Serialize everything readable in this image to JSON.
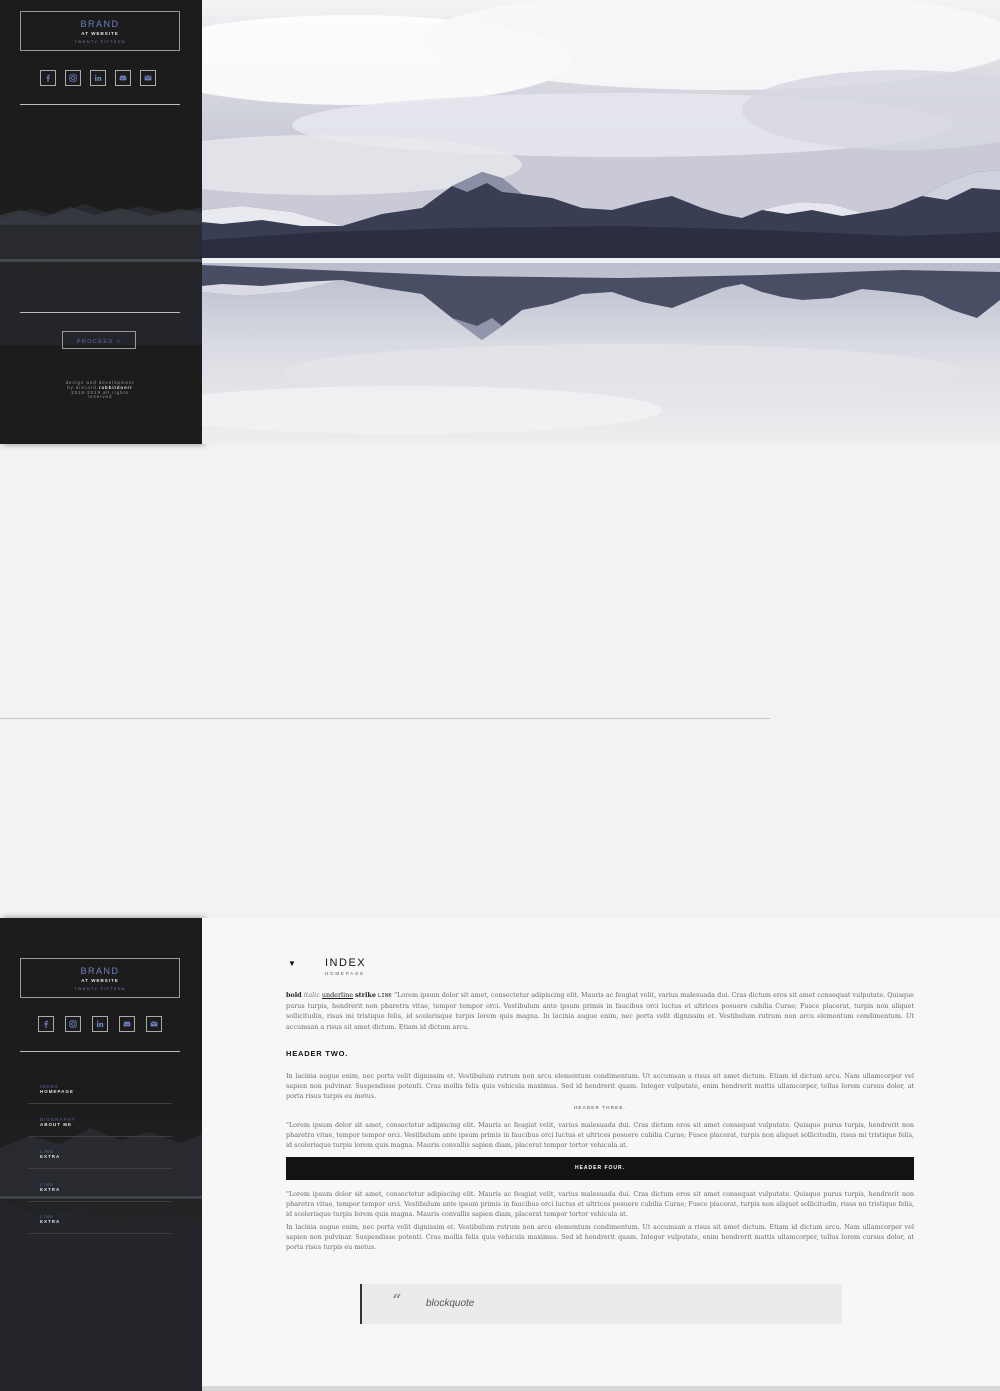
{
  "brand": {
    "title": "BRAND",
    "subtitle": "AT WEBSITE",
    "year": "- TWENTY FIFTEEN -"
  },
  "social": [
    "facebook-icon",
    "instagram-icon",
    "linkedin-icon",
    "discord-icon",
    "mail-icon"
  ],
  "hero": {
    "proceed_label": "PROCEED »",
    "credits_line1": "design and development",
    "credits_line2_prefix": "by discord",
    "credits_handle": "rabbitdoerr",
    "credits_line3": "2018-2019 all rights",
    "credits_line4": "reserved"
  },
  "nav": [
    {
      "top": "INDEX",
      "bottom": "HOMEPAGE"
    },
    {
      "top": "BIOGRAPHY",
      "bottom": "ABOUT ME"
    },
    {
      "top": "LINK",
      "bottom": "EXTRA"
    },
    {
      "top": "LINK",
      "bottom": "EXTRA"
    },
    {
      "top": "LINK",
      "bottom": "EXTRA"
    }
  ],
  "page": {
    "arrow": "▼",
    "title": "INDEX",
    "subtitle": "HOMEPAGE",
    "p1_bold": "bold",
    "p1_italic": "italic",
    "p1_underline": "underline",
    "p1_strike": "strike",
    "p1_link": "LINK",
    "p1_text": "\"Lorem ipsum dolor sit amet, consectetur adipiscing elit. Mauris ac feugiat velit, varius malesuada dui. Cras dictum eros sit amet consequat vulputate. Quisque purus turpis, hendrerit non pharetra vitae, tempor tempor orci. Vestibulum ante ipsum primis in faucibus orci luctus et ultrices posuere cubilia Curae; Fusce placerat, turpis non aliquet sollicitudin, risus mi tristique felis, id scelerisque turpis lorem quis magna. In lacinia augue enim, nec porta velit dignissim et. Vestibulum rutrum non arcu elementum condimentum. Ut accumsan a risus sit amet dictum. Etiam id dictum arcu.",
    "header_two": "HEADER TWO.",
    "p2": "In lacinia augue enim, nec porta velit dignissim et. Vestibulum rutrum non arcu elementum condimentum. Ut accumsan a risus sit amet dictum. Etiam id dictum arcu. Nam ullamcorper vel sapien non pulvinar. Suspendisse potenti. Cras mollis felis quis vehicula maximus. Sed id hendrerit quam. Integer vulputate, enim hendrerit mattis ullamcorper, tellus lorem cursus dolor, at porta risus turpis eu metus.",
    "header_three": "HEADER THREE.",
    "p3": "\"Lorem ipsum dolor sit amet, consectetur adipiscing elit. Mauris ac feugiat velit, varius malesuada dui. Cras dictum eros sit amet consequat vulputate. Quisque purus turpis, hendrerit non pharetra vitae, tempor tempor orci. Vestibulum ante ipsum primis in faucibus orci luctus et ultrices posuere cubilia Curae; Fusce placerat, turpis non aliquet sollicitudin, risus mi tristique felis, id scelerisque turpis lorem quis magna. Mauris convallis sapien diam, placerat tempor tortor vehicula at.",
    "header_four": "HEADER FOUR.",
    "p4": "\"Lorem ipsum dolor sit amet, consectetur adipiscing elit. Mauris ac feugiat velit, varius malesuada dui. Cras dictum eros sit amet consequat vulputate. Quisque purus turpis, hendrerit non pharetra vitae, tempor tempor orci. Vestibulum ante ipsum primis in faucibus orci luctus et ultrices posuere cubilia Curae; Fusce placerat, turpis non aliquet sollicitudin, risus mi tristique felis, id scelerisque turpis lorem quis magna. Mauris convallis sapien diam, placerat tempor tortor vehicula at.",
    "p5": "In lacinia augue enim, nec porta velit dignissim et. Vestibulum rutrum non arcu elementum condimentum. Ut accumsan a risus sit amet dictum. Etiam id dictum arcu. Nam ullamcorper vel sapien non pulvinar. Suspendisse potenti. Cras mollis felis quis vehicula maximus. Sed id hendrerit quam. Integer vulputate, enim hendrerit mattis ullamcorper, tellus lorem cursus dolor, at porta risus turpis eu metus.",
    "quote_mark": "“",
    "blockquote": "blockquote"
  },
  "colors": {
    "accent": "#6e7fc0",
    "sidebar_bg": "#1c1c1c",
    "header_four_bg": "#131313"
  }
}
